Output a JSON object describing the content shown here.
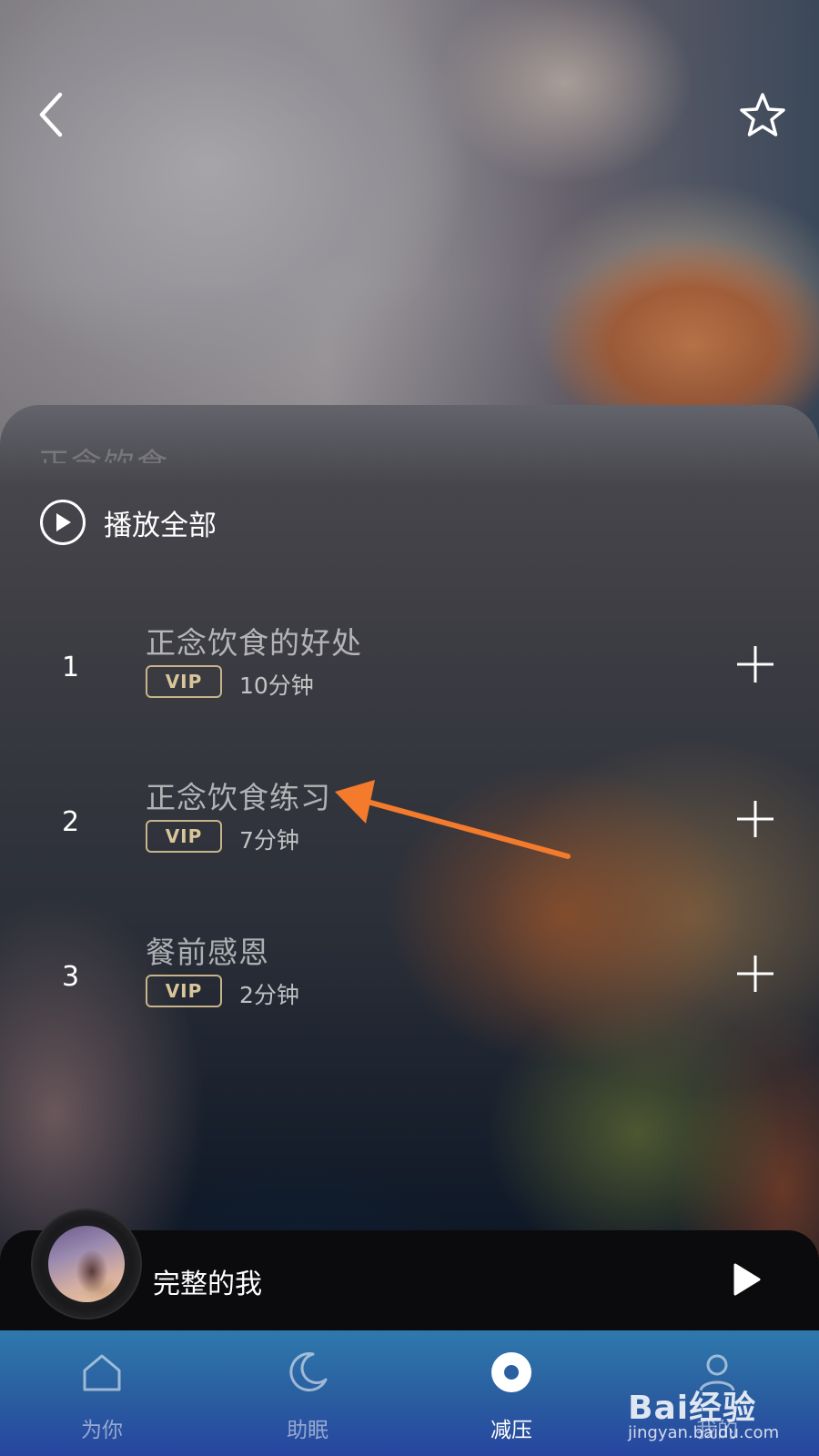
{
  "header": {
    "back_icon": "chevron-left-icon",
    "favorite_icon": "star-outline-icon"
  },
  "panel": {
    "faded_title": "正念饮食"
  },
  "play_all": {
    "icon": "play-circle-icon",
    "label": "播放全部"
  },
  "tracks": [
    {
      "index": "1",
      "title": "正念饮食的好处",
      "badge": "VIP",
      "duration": "10分钟"
    },
    {
      "index": "2",
      "title": "正念饮食练习",
      "badge": "VIP",
      "duration": "7分钟"
    },
    {
      "index": "3",
      "title": "餐前感恩",
      "badge": "VIP",
      "duration": "2分钟"
    }
  ],
  "mini_player": {
    "title": "完整的我",
    "play_icon": "play-icon"
  },
  "tabs": [
    {
      "label": "为你",
      "icon": "home-icon",
      "active": false
    },
    {
      "label": "助眠",
      "icon": "moon-icon",
      "active": false
    },
    {
      "label": "减压",
      "icon": "disc-icon",
      "active": true
    },
    {
      "label": "我的",
      "icon": "profile-icon",
      "active": false
    }
  ],
  "watermark": {
    "brand": "Bai经验",
    "url": "jingyan.baidu.com"
  },
  "colors": {
    "vip_gold": "#c8b48a",
    "tab_bar": "#2a5fa0",
    "annotation_arrow": "#f47a2c"
  }
}
